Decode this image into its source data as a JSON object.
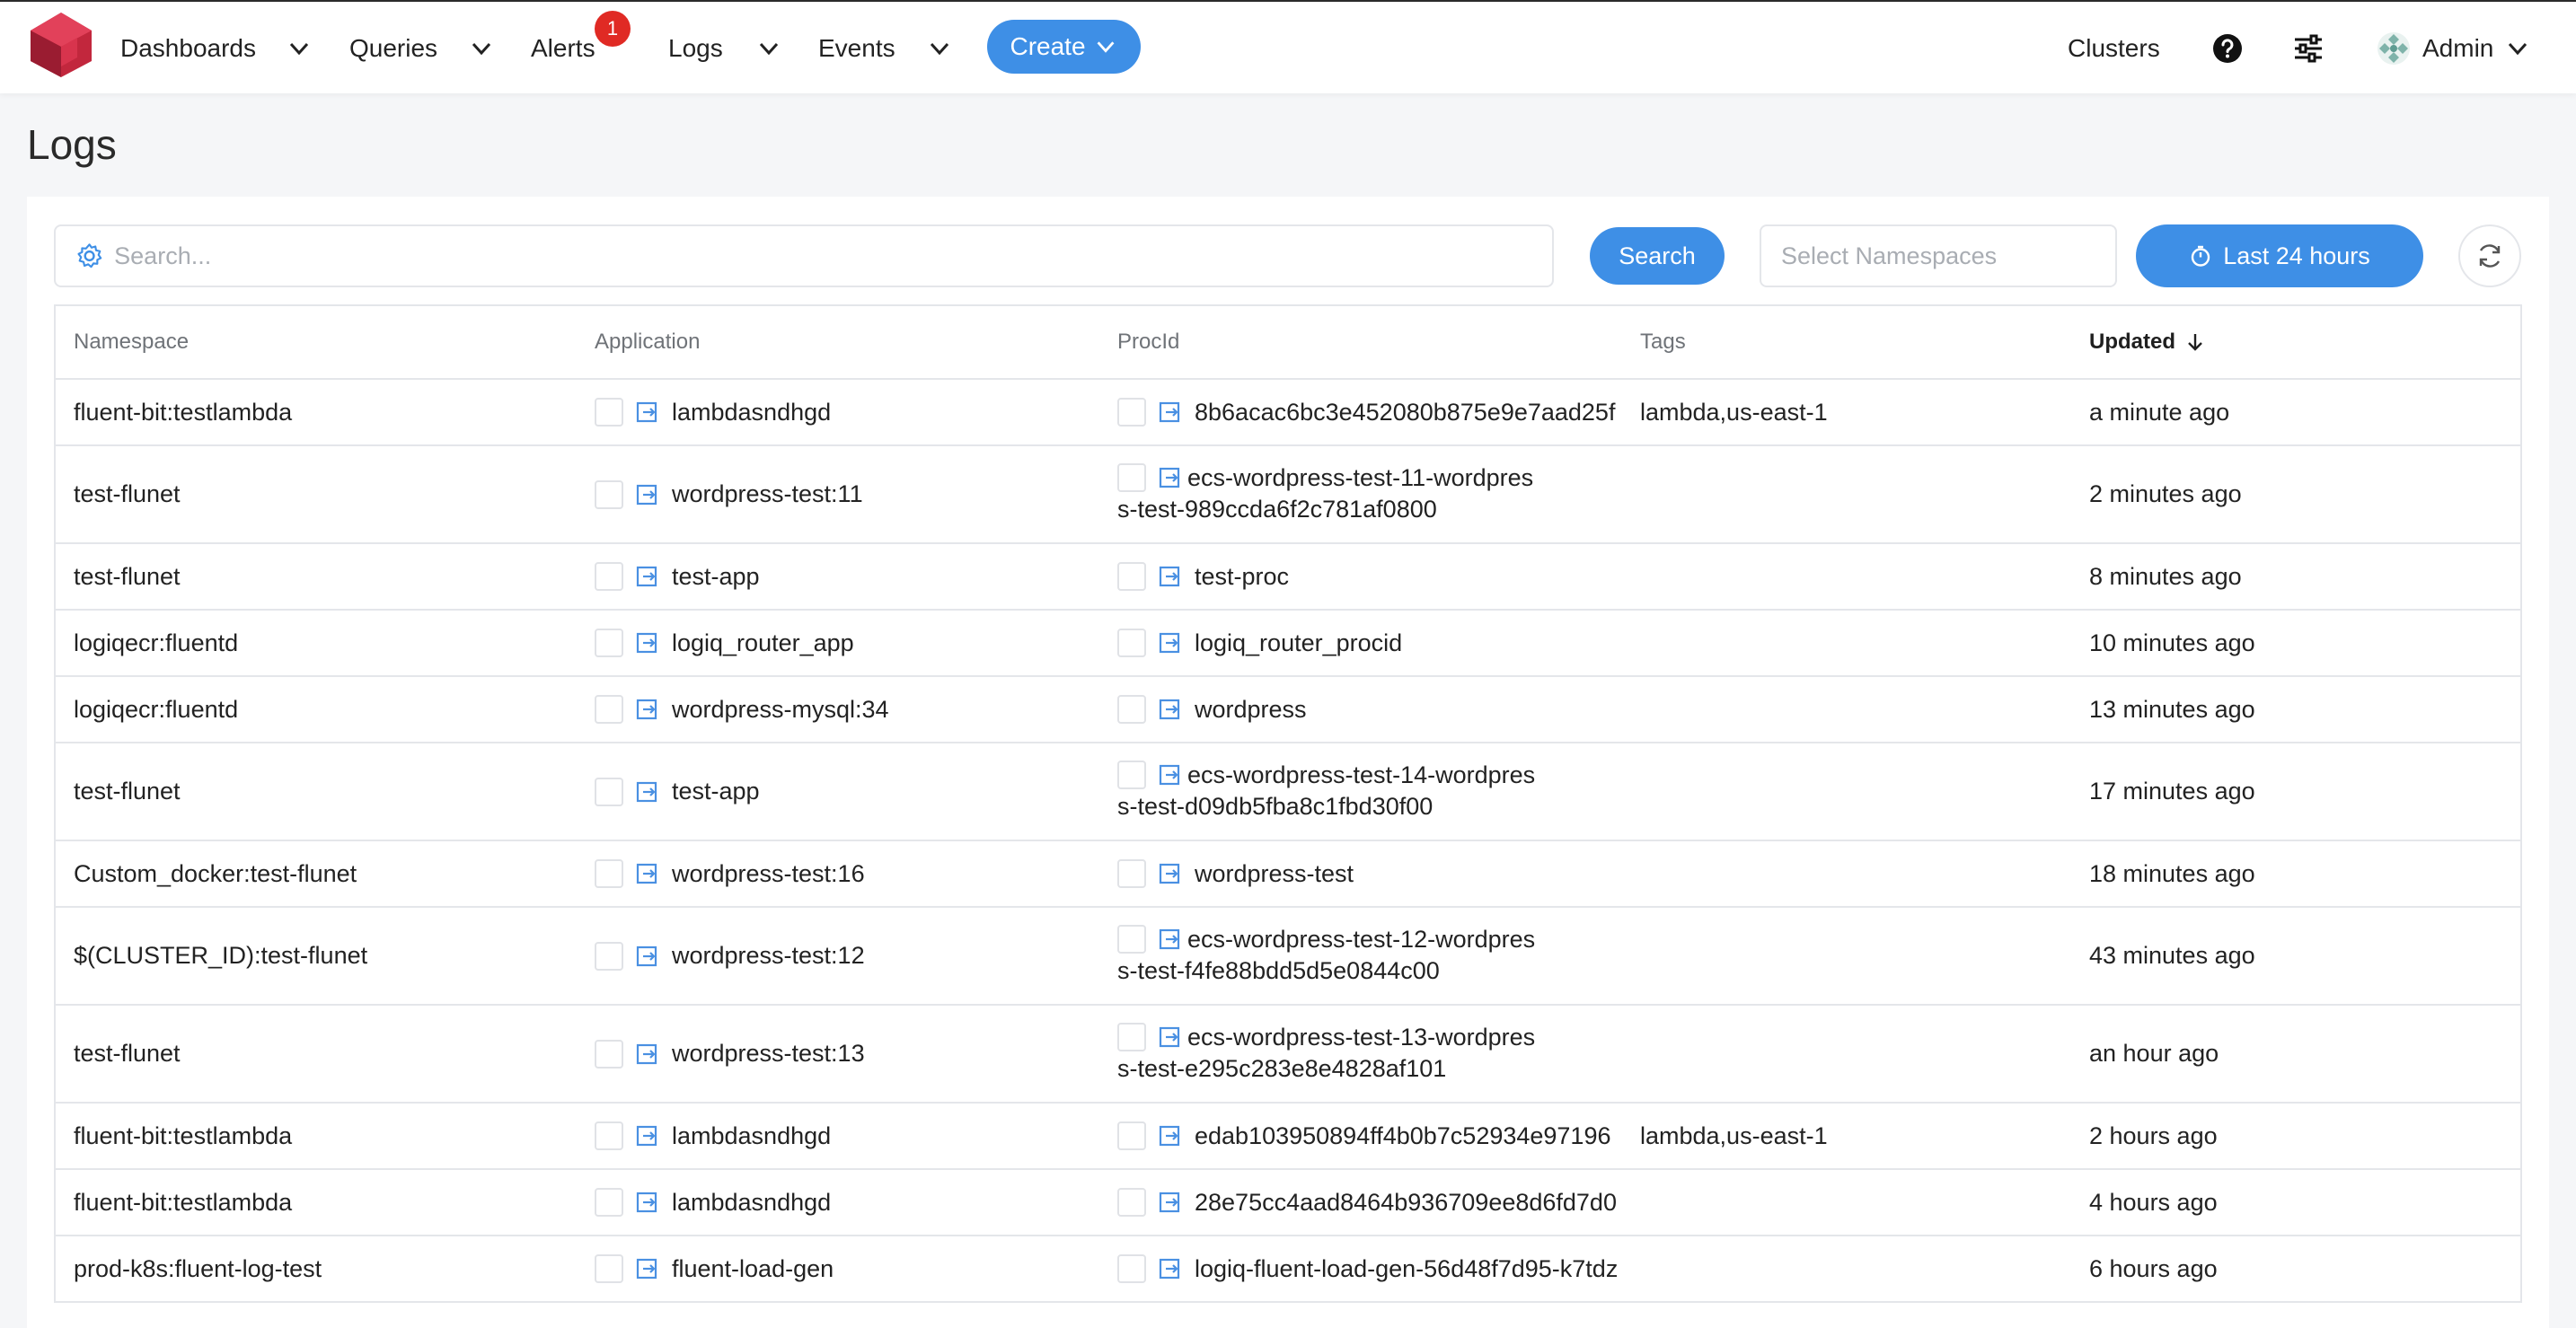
{
  "nav": {
    "items": [
      {
        "label": "Dashboards"
      },
      {
        "label": "Queries"
      },
      {
        "label": "Alerts",
        "badge": "1"
      },
      {
        "label": "Logs"
      },
      {
        "label": "Events"
      }
    ],
    "create_label": "Create",
    "clusters_label": "Clusters",
    "user_label": "Admin",
    "icons": {
      "help": "question-circle-icon",
      "settings": "sliders-icon",
      "avatar": "avatar-icon"
    },
    "accent": "#3e8fe6",
    "badge_color": "#e02a24"
  },
  "page": {
    "title": "Logs"
  },
  "toolbar": {
    "search_placeholder": "Search...",
    "search_button": "Search",
    "namespace_placeholder": "Select Namespaces",
    "time_range": "Last 24 hours"
  },
  "table": {
    "columns": [
      "Namespace",
      "Application",
      "ProcId",
      "Tags",
      "Updated"
    ],
    "sorted_column": "Updated",
    "sort_direction": "descending",
    "rows": [
      {
        "namespace": "fluent-bit:testlambda",
        "application": "lambdasndhgd",
        "procid": "8b6acac6bc3e452080b875e9e7aad25f",
        "tags": "lambda,us-east-1",
        "updated": "a minute ago"
      },
      {
        "namespace": "test-flunet",
        "application": "wordpress-test:11",
        "procid": "ecs-wordpress-test-11-wordpress-test-989ccda6f2c781af0800",
        "tags": "",
        "updated": "2 minutes ago"
      },
      {
        "namespace": "test-flunet",
        "application": "test-app",
        "procid": "test-proc",
        "tags": "",
        "updated": "8 minutes ago"
      },
      {
        "namespace": "logiqecr:fluentd",
        "application": "logiq_router_app",
        "procid": " logiq_router_procid",
        "tags": "",
        "updated": "10 minutes ago"
      },
      {
        "namespace": "logiqecr:fluentd",
        "application": "wordpress-mysql:34",
        "procid": "wordpress",
        "tags": "",
        "updated": "13 minutes ago"
      },
      {
        "namespace": "test-flunet",
        "application": "test-app",
        "procid": "ecs-wordpress-test-14-wordpress-test-d09db5fba8c1fbd30f00",
        "tags": "",
        "updated": "17 minutes ago"
      },
      {
        "namespace": "Custom_docker:test-flunet",
        "application": "wordpress-test:16",
        "procid": "wordpress-test",
        "tags": "",
        "updated": "18 minutes ago"
      },
      {
        "namespace": "$(CLUSTER_ID):test-flunet",
        "application": "wordpress-test:12",
        "procid": "ecs-wordpress-test-12-wordpress-test-f4fe88bdd5d5e0844c00",
        "tags": "",
        "updated": "43 minutes ago"
      },
      {
        "namespace": "test-flunet",
        "application": "wordpress-test:13",
        "procid": "ecs-wordpress-test-13-wordpress-test-e295c283e8e4828af101",
        "tags": "",
        "updated": "an hour ago"
      },
      {
        "namespace": "fluent-bit:testlambda",
        "application": "lambdasndhgd",
        "procid": "edab103950894ff4b0b7c52934e97196",
        "tags": "lambda,us-east-1",
        "updated": "2 hours ago"
      },
      {
        "namespace": "fluent-bit:testlambda",
        "application": "lambdasndhgd",
        "procid": "28e75cc4aad8464b936709ee8d6fd7d0",
        "tags": "",
        "updated": "4 hours ago"
      },
      {
        "namespace": "prod-k8s:fluent-log-test",
        "application": "fluent-load-gen",
        "procid": "logiq-fluent-load-gen-56d48f7d95-k7tdz",
        "tags": "",
        "updated": "6 hours ago"
      }
    ]
  }
}
